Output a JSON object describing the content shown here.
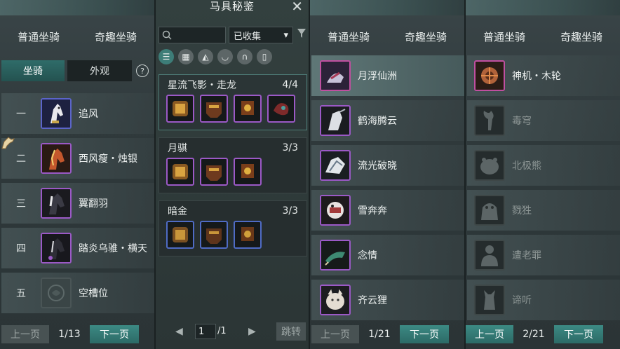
{
  "left_panel": {
    "categories": [
      "普通坐骑",
      "奇趣坐骑"
    ],
    "subtabs": {
      "active": "坐骑",
      "inactive": "外观"
    },
    "help": "?",
    "slots": [
      {
        "index": "一",
        "name": "追风"
      },
      {
        "index": "二",
        "name": "西风瘦・烛银"
      },
      {
        "index": "三",
        "name": "翼翻羽"
      },
      {
        "index": "四",
        "name": "踏炎乌骓・横天"
      },
      {
        "index": "五",
        "name": "空槽位"
      }
    ],
    "pager": {
      "prev": "上一页",
      "page": "1/13",
      "next": "下一页"
    }
  },
  "codex_panel": {
    "title": "马具秘鉴",
    "filter_value": "已收集",
    "sets": [
      {
        "name": "星流飞影・走龙",
        "count": "4/4"
      },
      {
        "name": "月骐",
        "count": "3/3"
      },
      {
        "name": "暗金",
        "count": "3/3"
      }
    ],
    "pager": {
      "page_input": "1",
      "total": "/1",
      "jump": "跳转"
    }
  },
  "mid_panel": {
    "categories": [
      "普通坐骑",
      "奇趣坐骑"
    ],
    "items": [
      "月浮仙洲",
      "鹤海腾云",
      "流光破晓",
      "雪奔奔",
      "念情",
      "齐云狸"
    ],
    "pager": {
      "prev": "上一页",
      "page": "1/21",
      "next": "下一页"
    }
  },
  "right_panel": {
    "categories": [
      "普通坐骑",
      "奇趣坐骑"
    ],
    "items": [
      "神机・木轮",
      "毒穹",
      "北极熊",
      "戮狌",
      "遭老罪",
      "谛听"
    ],
    "pager": {
      "prev": "上一页",
      "page": "2/21",
      "next": "下一页"
    }
  },
  "colors": {
    "teal": "#2f6c69",
    "purple_frame": "#9b59c6",
    "blue_frame": "#4f6bc4"
  }
}
